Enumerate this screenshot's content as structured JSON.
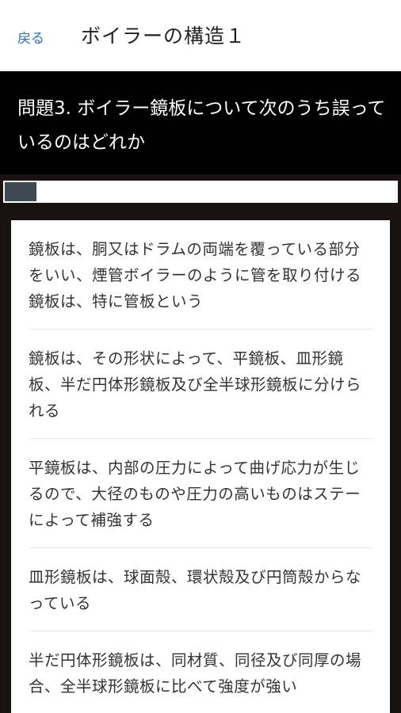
{
  "header": {
    "back_label": "戻る",
    "title": "ボイラーの構造１"
  },
  "question": {
    "text": "問題3. ボイラー鏡板について次のうち誤っているのはどれか"
  },
  "progress": {
    "value": 0.08
  },
  "answers": [
    "鏡板は、胴又はドラムの両端を覆っている部分をいい、煙管ボイラーのように管を取り付ける鏡板は、特に管板という",
    "鏡板は、その形状によって、平鏡板、皿形鏡板、半だ円体形鏡板及び全半球形鏡板に分けられる",
    "平鏡板は、内部の圧力によって曲げ応力が生じるので、大径のものや圧力の高いものはステーによって補強する",
    "皿形鏡板は、球面殻、環状殻及び円筒殻からなっている",
    "半だ円体形鏡板は、同材質、同径及び同厚の場合、全半球形鏡板に比べて強度が強い"
  ]
}
